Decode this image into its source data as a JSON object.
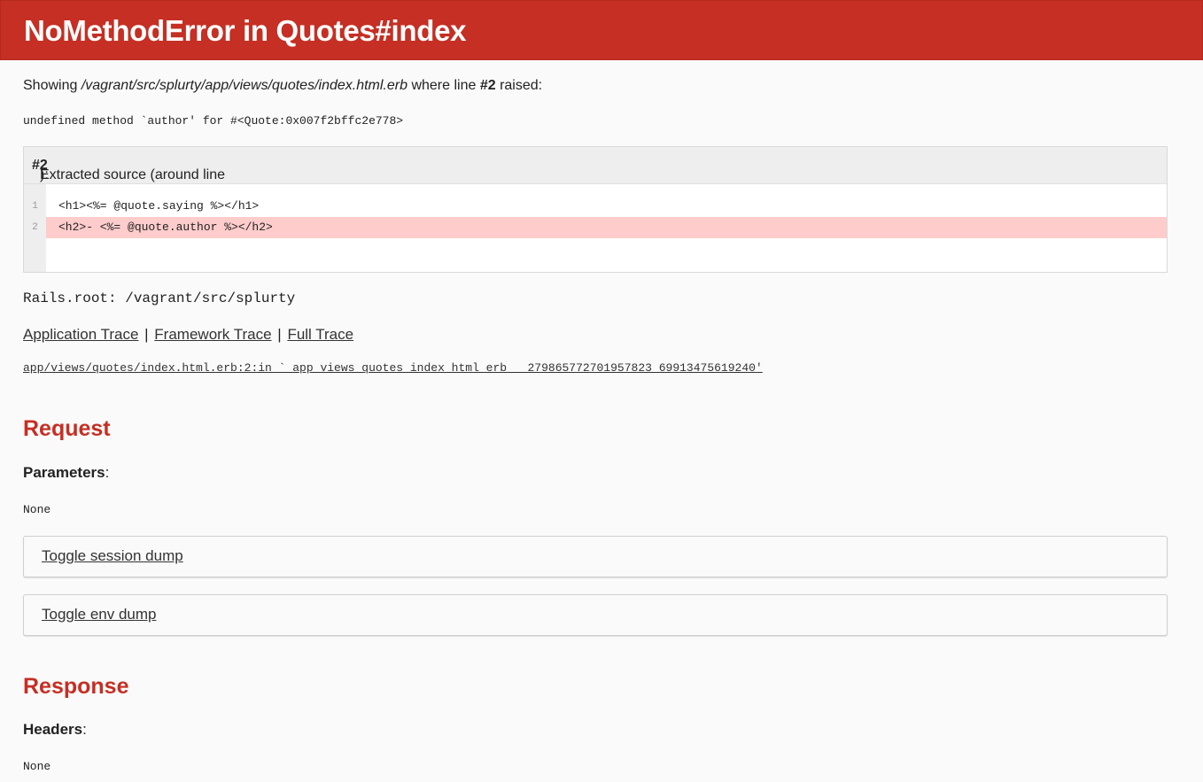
{
  "header": {
    "title": "NoMethodError in Quotes#index"
  },
  "error": {
    "showing_prefix": "Showing ",
    "template_path": "/vagrant/src/splurty/app/views/quotes/index.html.erb",
    "where_line": " where line ",
    "line_ref": "#2",
    "raised": " raised:",
    "message": "undefined method `author' for #<Quote:0x007f2bffc2e778>"
  },
  "source": {
    "heading_prefix": "Extracted source (around line ",
    "heading_line": "#2",
    "heading_suffix": "):",
    "lines": [
      {
        "number": "1",
        "code": "<h1><%= @quote.saying %></h1>"
      },
      {
        "number": "2",
        "code": "<h2>- <%= @quote.author %></h2>"
      }
    ],
    "highlighted_line": 2
  },
  "rails_root": "Rails.root: /vagrant/src/splurty",
  "traces": {
    "application": "Application Trace",
    "framework": "Framework Trace",
    "full": "Full Trace",
    "separator": "|",
    "entry": "app/views/quotes/index.html.erb:2:in `_app_views_quotes_index_html_erb___279865772701957823_69913475619240'"
  },
  "request": {
    "heading": "Request",
    "parameters_label": "Parameters",
    "parameters_value": "None",
    "toggle_session": "Toggle session dump",
    "toggle_env": "Toggle env dump"
  },
  "response": {
    "heading": "Response",
    "headers_label": "Headers",
    "headers_value": "None"
  },
  "colors": {
    "header_bg": "#c52f24",
    "highlight_bg": "#ffcccc",
    "section_heading": "#c52f24",
    "page_bg": "#fafafa"
  }
}
